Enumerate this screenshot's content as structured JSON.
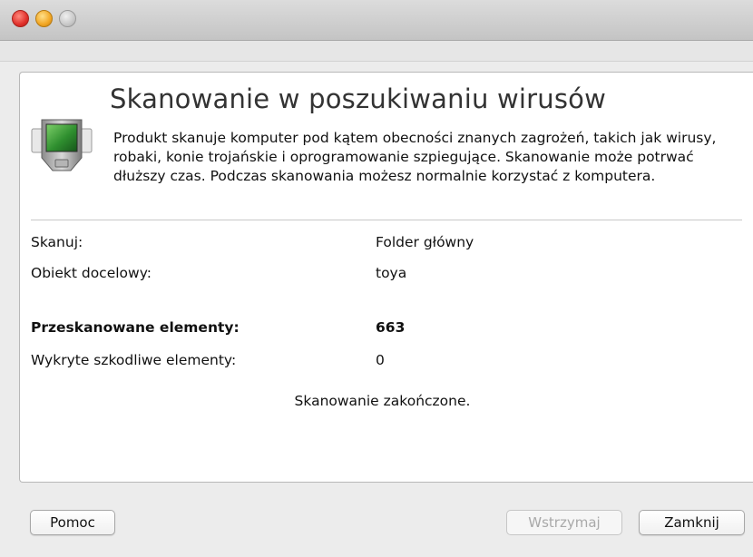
{
  "window": {
    "controls": [
      "close",
      "minimize",
      "zoom"
    ]
  },
  "header": {
    "title": "Skanowanie w poszukiwaniu wirusów",
    "description": "Produkt skanuje komputer pod kątem obecności znanych zagrożeń, takich jak wirusy, robaki, konie trojańskie i oprogramowanie szpiegujące. Skanowanie może potrwać dłuższy czas. Podczas skanowania możesz normalnie korzystać z komputera.",
    "icon": "scanner-device-icon"
  },
  "details": {
    "scan_label": "Skanuj:",
    "scan_value": "Folder główny",
    "target_label": "Obiekt docelowy:",
    "target_value": "toya",
    "scanned_label": "Przeskanowane elementy:",
    "scanned_value": "663",
    "detected_label": "Wykryte szkodliwe elementy:",
    "detected_value": "0"
  },
  "status": {
    "text": "Skanowanie zakończone."
  },
  "buttons": {
    "help": "Pomoc",
    "pause": "Wstrzymaj",
    "pause_enabled": false,
    "close": "Zamknij"
  }
}
